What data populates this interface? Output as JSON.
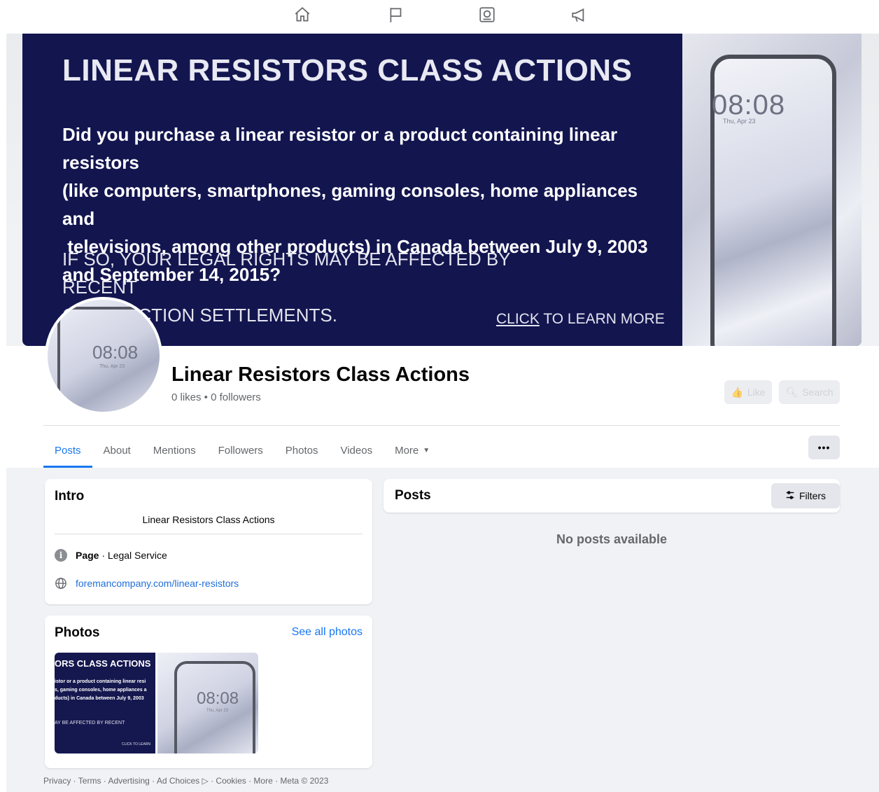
{
  "topnav": {
    "icons": [
      "home-icon",
      "flag-icon",
      "news-icon",
      "megaphone-icon"
    ]
  },
  "cover": {
    "title": "LINEAR RESISTORS CLASS ACTIONS",
    "question_lines": [
      "Did you purchase a linear resistor or a product containing linear resistors",
      "(like computers, smartphones, gaming consoles, home appliances and",
      " televisions, among other products) in Canada between July 9, 2003",
      "and September 14, 2015?"
    ],
    "note_lines": [
      "IF SO, YOUR LEGAL RIGHTS MAY BE AFFECTED BY RECENT",
      "CLASS ACTION SETTLEMENTS."
    ],
    "cta_link": "CLICK",
    "cta_rest": " TO LEARN MORE",
    "phone_time": "08:08",
    "phone_date": "Thu, Apr 23"
  },
  "profile": {
    "name": "Linear Resistors Class Actions",
    "stats": "0 likes • 0 followers",
    "avatar_time": "08:08",
    "avatar_date": "Thu, Apr 23",
    "like_label": "Like",
    "search_label": "Search"
  },
  "tabs": [
    {
      "label": "Posts",
      "active": true
    },
    {
      "label": "About"
    },
    {
      "label": "Mentions"
    },
    {
      "label": "Followers"
    },
    {
      "label": "Photos"
    },
    {
      "label": "Videos"
    },
    {
      "label": "More"
    }
  ],
  "more_dots": "•••",
  "intro": {
    "title": "Intro",
    "bio": "Linear Resistors Class Actions",
    "category_bold": "Page",
    "category_rest": " · Legal Service",
    "website": "foremancompany.com/linear-resistors"
  },
  "photos": {
    "title": "Photos",
    "see_all": "See all photos",
    "thumb1_title": "ORS CLASS ACTIONS",
    "thumb1_body": [
      "istor or a product containing linear resi",
      "s, gaming consoles, home appliances a",
      "ducts) in Canada between July 9, 2003"
    ],
    "thumb1_note": "AY BE AFFECTED BY RECENT",
    "thumb1_cta": "CLICK TO LEARN",
    "thumb2_time": "08:08",
    "thumb2_date": "Thu, Apr 23"
  },
  "posts": {
    "title": "Posts",
    "filters_label": "Filters",
    "empty_text": "No posts available"
  },
  "footer": {
    "text": "Privacy · Terms · Advertising · Ad Choices ▷ · Cookies · More · Meta © 2023"
  },
  "colors": {
    "cover_bg": "#13154f",
    "accent": "#1877f2",
    "page_bg": "#f0f2f5"
  }
}
